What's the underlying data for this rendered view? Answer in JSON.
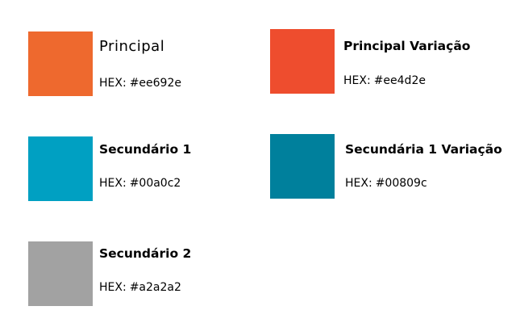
{
  "hex_prefix": "HEX:",
  "colors": [
    {
      "name": "Principal",
      "hex": "#ee692e",
      "color": "#ee692e"
    },
    {
      "name": "Principal Variação",
      "hex": "#ee4d2e",
      "color": "#ee4d2e"
    },
    {
      "name": "Secundário 1",
      "hex": "#00a0c2",
      "color": "#00a0c2"
    },
    {
      "name": "Secundária 1 Variação",
      "hex": "#00809c",
      "color": "#00809c"
    },
    {
      "name": "Secundário 2",
      "hex": "#a2a2a2",
      "color": "#a2a2a2"
    }
  ]
}
